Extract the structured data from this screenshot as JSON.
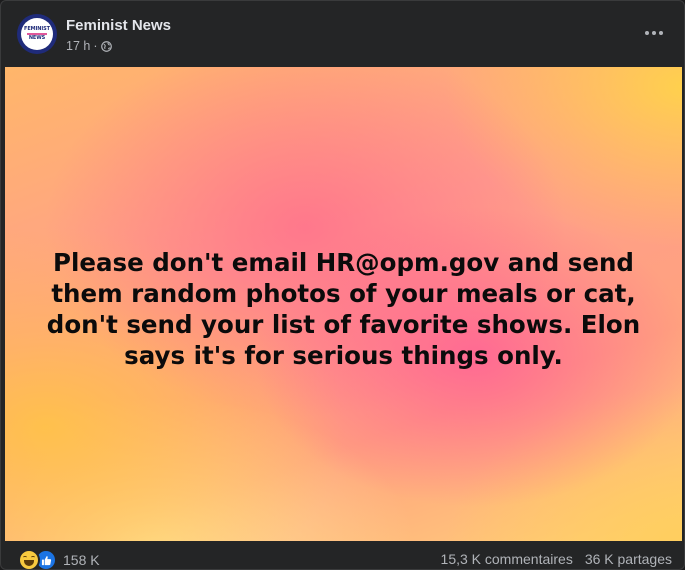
{
  "post": {
    "page_name": "Feminist News",
    "time": "17 h",
    "separator": "·",
    "privacy_icon": "globe-icon",
    "avatar_text_line1": "FEMINIST",
    "avatar_text_line2": "NEWS",
    "text": "Please don't email HR@opm.gov and send them random photos of your meals or cat, don't send your list of favorite shows. Elon says it's for serious things only."
  },
  "footer": {
    "reaction_icons": [
      "haha-reaction-icon",
      "like-reaction-icon"
    ],
    "reaction_count": "158 K",
    "comments": "15,3 K commentaires",
    "shares": "36 K partages"
  },
  "colors": {
    "card_bg": "#242526",
    "primary_text": "#e4e6eb",
    "secondary_text": "#b0b3b8",
    "like_blue": "#1b74e4",
    "haha_yellow": "#f7c93f"
  }
}
